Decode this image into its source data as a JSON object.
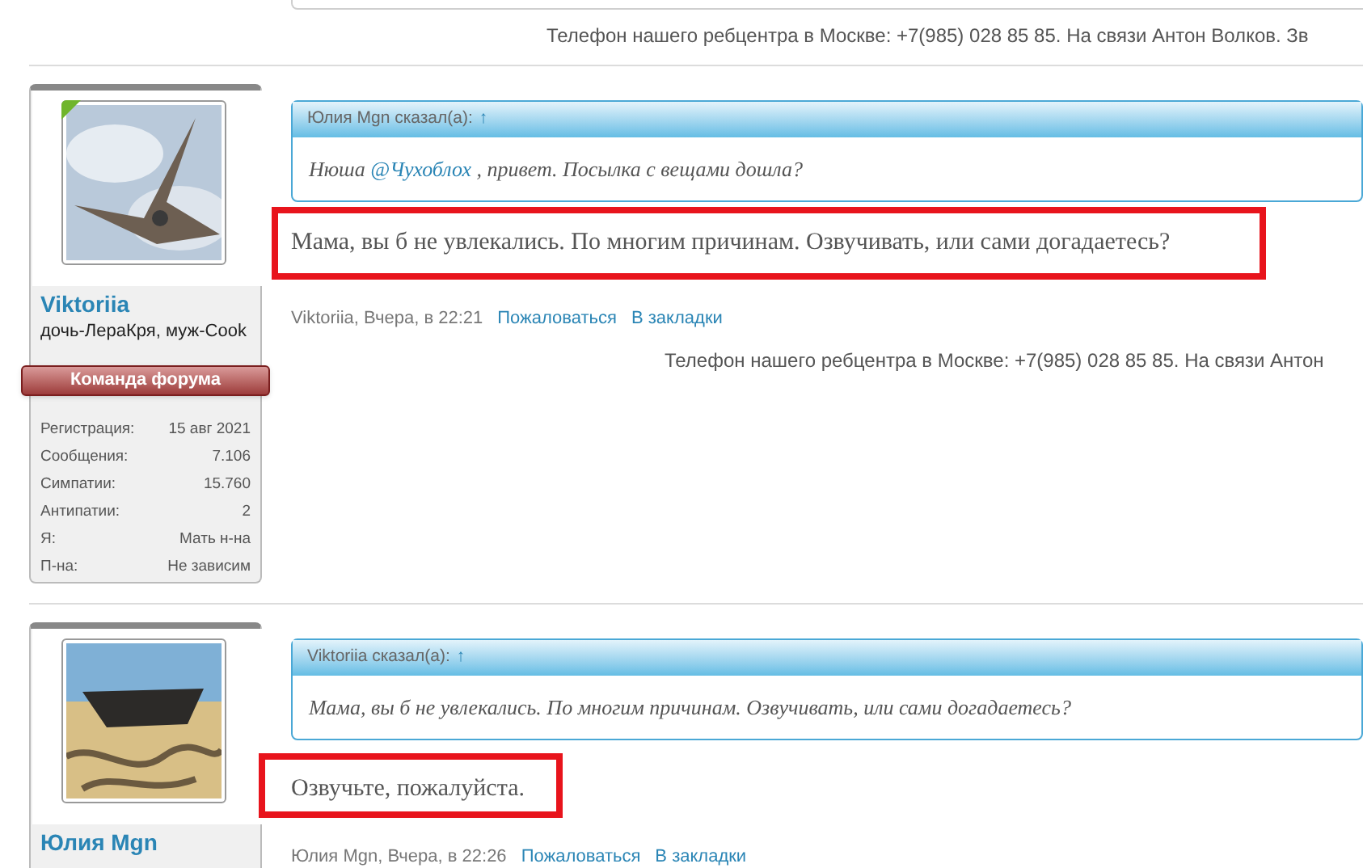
{
  "top_signature": "Телефон нашего ребцентра в Москве: +7(985) 028 85 85. На связи Антон Волков. Зв",
  "posts": [
    {
      "author": "Viktoriia",
      "user_title": "дочь-ЛераКря, муж-Cook",
      "online": true,
      "banner": "Команда форума",
      "stats": [
        {
          "label": "Регистрация:",
          "value": "15 авг 2021"
        },
        {
          "label": "Сообщения:",
          "value": "7.106"
        },
        {
          "label": "Симпатии:",
          "value": "15.760"
        },
        {
          "label": "Антипатии:",
          "value": "2"
        },
        {
          "label": "Я:",
          "value": "Мать н-на"
        },
        {
          "label": "П-на:",
          "value": "Не зависим"
        }
      ],
      "quote": {
        "header": "Юлия Mgn сказал(а):",
        "arrow": "↑",
        "text_before": "Нюша ",
        "mention": "@Чухоблох",
        "text_after": " , привет. Посылка с вещами дошла?"
      },
      "message": "Мама, вы б не увлекались. По многим причинам. Озвучивать, или сами догадаетесь?",
      "highlighted": true,
      "meta": "Viktoriia, Вчера, в 22:21",
      "links": [
        "Пожаловаться",
        "В закладки"
      ],
      "signature": "Телефон нашего ребцентра в Москве: +7(985) 028 85 85. На связи Антон"
    },
    {
      "author": "Юлия Mgn",
      "online": false,
      "quote": {
        "header": "Viktoriia сказал(а):",
        "arrow": "↑",
        "text_before": "Мама, вы б не увлекались. По многим причинам. Озвучивать, или сами догадаетесь?"
      },
      "message": "Озвучьте, пожалуйста.",
      "highlighted": true,
      "meta": "Юлия Mgn, Вчера, в 22:26",
      "links": [
        "Пожаловаться",
        "В закладки"
      ]
    }
  ]
}
